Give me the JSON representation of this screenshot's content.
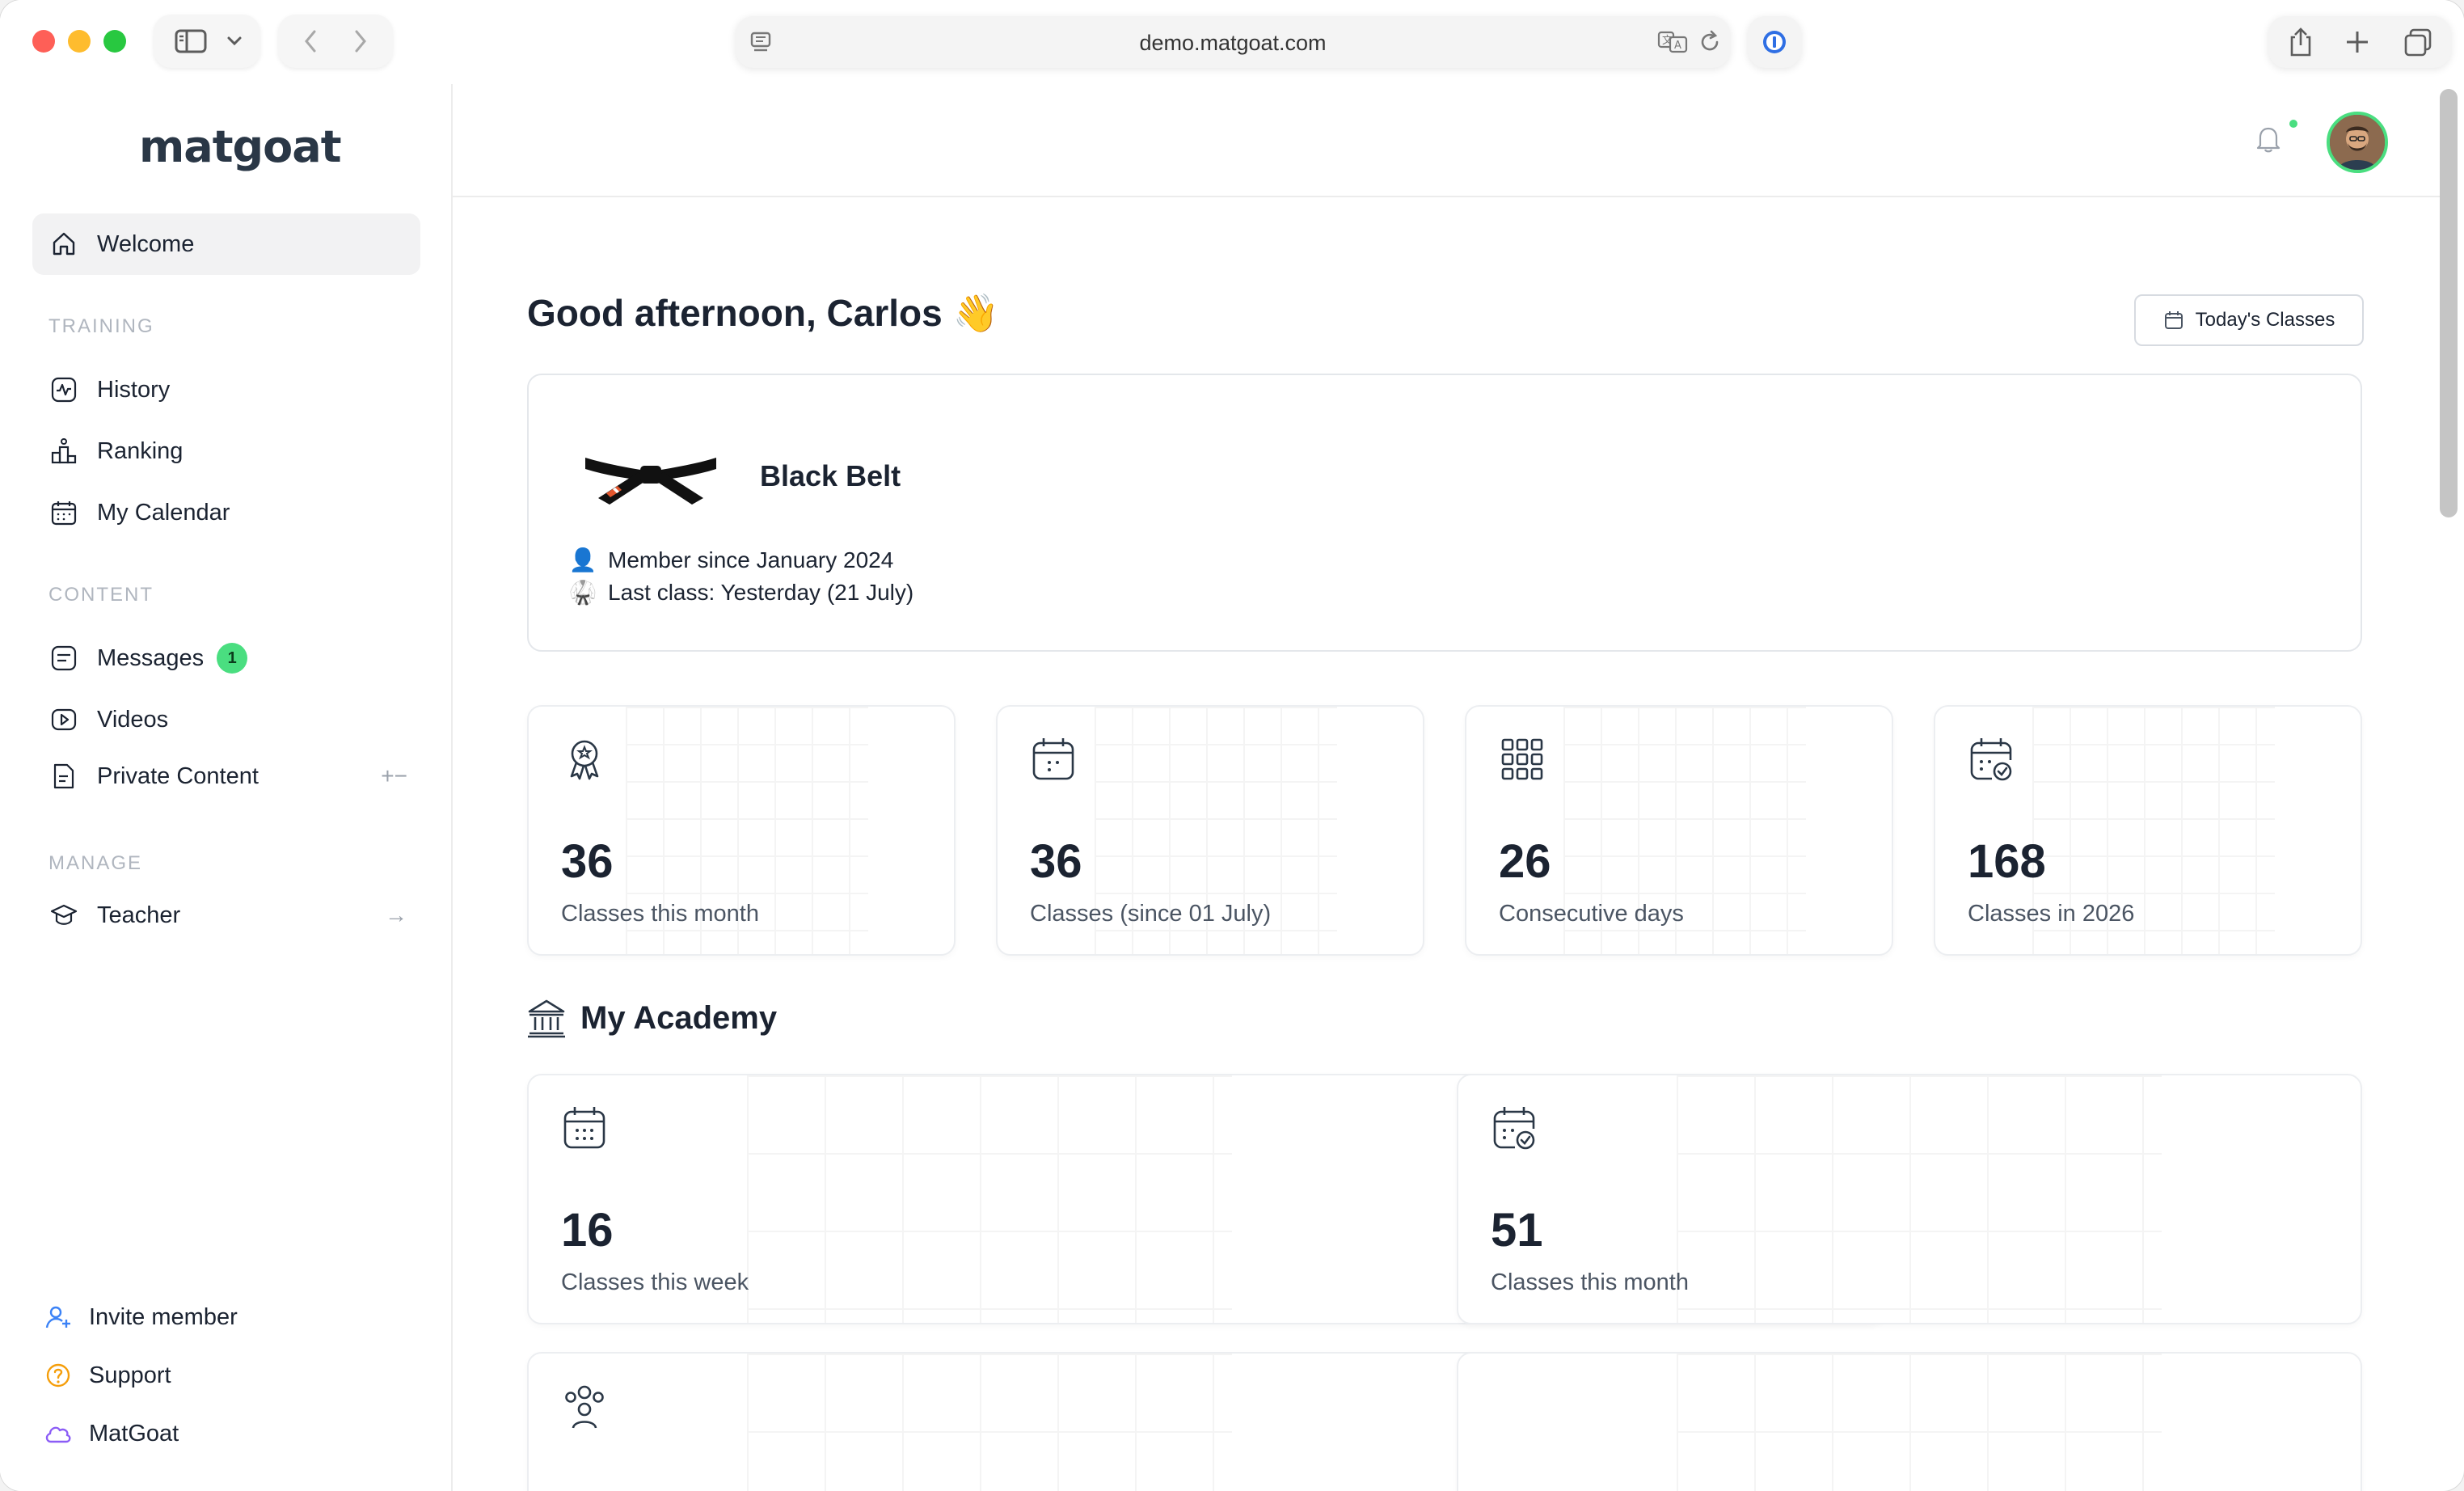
{
  "browser": {
    "url": "demo.matgoat.com"
  },
  "sidebar": {
    "logo": "matgoat",
    "welcome": "Welcome",
    "sections": {
      "training": "TRAINING",
      "content": "CONTENT",
      "manage": "MANAGE"
    },
    "training_items": [
      "History",
      "Ranking",
      "My Calendar"
    ],
    "content_items": {
      "messages": "Messages",
      "messages_badge": "1",
      "videos": "Videos",
      "private_content": "Private Content",
      "private_content_controls": "+−"
    },
    "manage_items": {
      "teacher": "Teacher",
      "teacher_arrow": "→"
    },
    "footer": {
      "invite": "Invite member",
      "support": "Support",
      "matgoat": "MatGoat"
    }
  },
  "header": {
    "greeting": "Good afternoon, Carlos 👋",
    "today_button": "Today's Classes"
  },
  "belt": {
    "name": "Black Belt",
    "member_since": "Member since January 2024",
    "last_class": "Last class: Yesterday (21 July)",
    "member_icon": "👤",
    "last_class_icon": "🥋"
  },
  "stats": [
    {
      "value": "36",
      "label": "Classes this month",
      "icon": "award-icon"
    },
    {
      "value": "36",
      "label": "Classes (since 01 July)",
      "icon": "calendar-icon"
    },
    {
      "value": "26",
      "label": "Consecutive days",
      "icon": "grid-icon"
    },
    {
      "value": "168",
      "label": "Classes in 2026",
      "icon": "calendar-check-icon"
    }
  ],
  "academy": {
    "title": "My Academy",
    "stats": [
      {
        "value": "16",
        "label": "Classes this week",
        "icon": "calendar-dots-icon"
      },
      {
        "value": "51",
        "label": "Classes this month",
        "icon": "calendar-check-icon"
      }
    ]
  },
  "colors": {
    "accent_green": "#4ade80",
    "text_primary": "#1b2331"
  }
}
